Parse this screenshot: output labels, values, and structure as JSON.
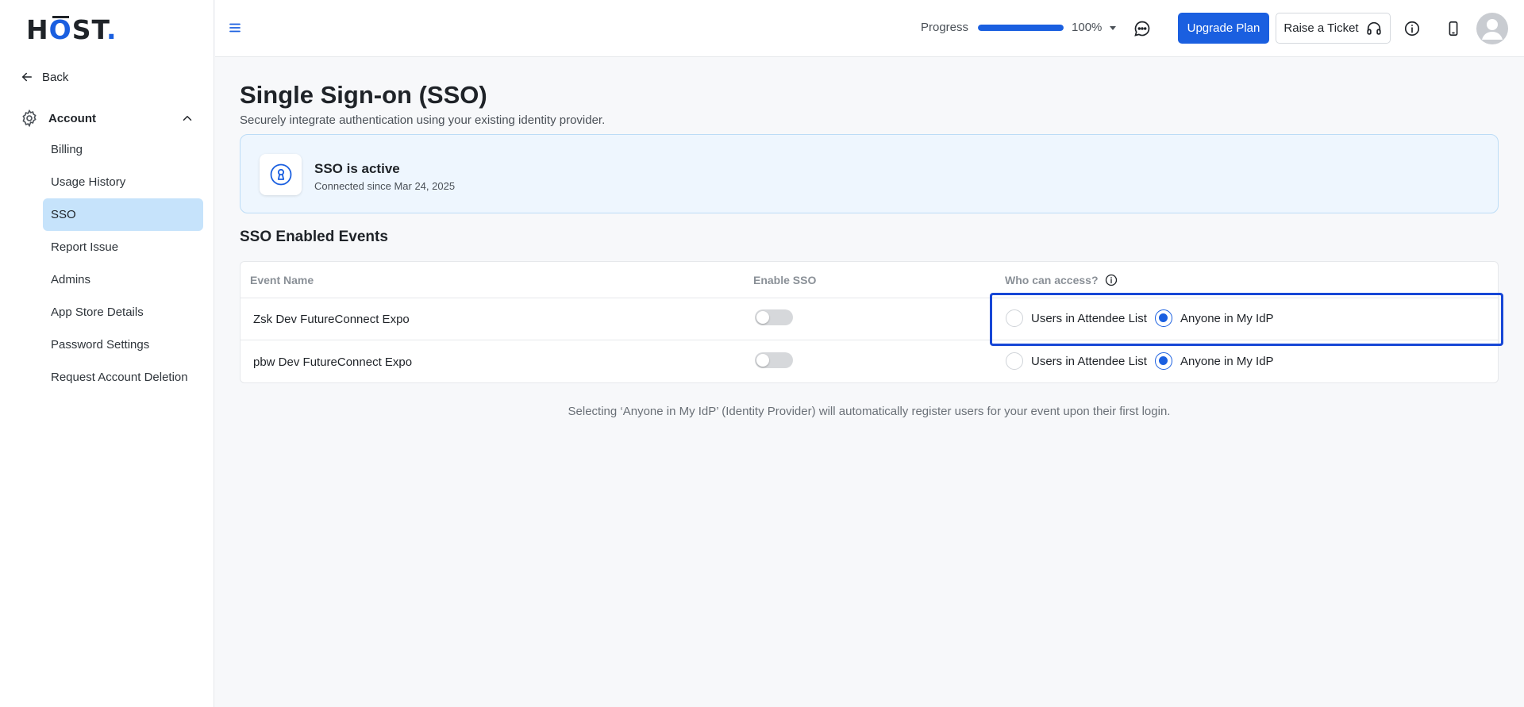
{
  "brand": {
    "logo_h": "H",
    "logo_o": "O",
    "logo_st": "ST",
    "logo_dot": "."
  },
  "sidebar": {
    "back_label": "Back",
    "section_label": "Account",
    "items": [
      {
        "label": "Billing",
        "active": false
      },
      {
        "label": "Usage History",
        "active": false
      },
      {
        "label": "SSO",
        "active": true
      },
      {
        "label": "Report Issue",
        "active": false
      },
      {
        "label": "Admins",
        "active": false
      },
      {
        "label": "App Store Details",
        "active": false
      },
      {
        "label": "Password Settings",
        "active": false
      },
      {
        "label": "Request Account Deletion",
        "active": false
      }
    ]
  },
  "topbar": {
    "progress_label": "Progress",
    "progress_value": 100,
    "progress_text": "100%",
    "upgrade_label": "Upgrade Plan",
    "ticket_label": "Raise a Ticket"
  },
  "page": {
    "title": "Single Sign-on (SSO)",
    "subtitle": "Securely integrate authentication using your existing identity provider."
  },
  "status": {
    "title": "SSO is active",
    "subtitle": "Connected since Mar 24, 2025"
  },
  "events": {
    "title": "SSO Enabled Events",
    "columns": {
      "name": "Event Name",
      "enable": "Enable SSO",
      "access": "Who can access?"
    },
    "option_attendee": "Users in Attendee List",
    "option_idp": "Anyone in My IdP",
    "rows": [
      {
        "name": "Zsk Dev FutureConnect Expo",
        "sso_enabled": false,
        "access": "idp"
      },
      {
        "name": "pbw Dev FutureConnect Expo",
        "sso_enabled": false,
        "access": "idp"
      }
    ]
  },
  "footnote": "Selecting ‘Anyone in My IdP’ (Identity Provider) will automatically register users for your event upon their first login.",
  "colors": {
    "accent": "#1a5fe0",
    "active_nav": "#c6e3fb",
    "status_bg": "#eef6fe",
    "highlight": "#1747d6"
  }
}
